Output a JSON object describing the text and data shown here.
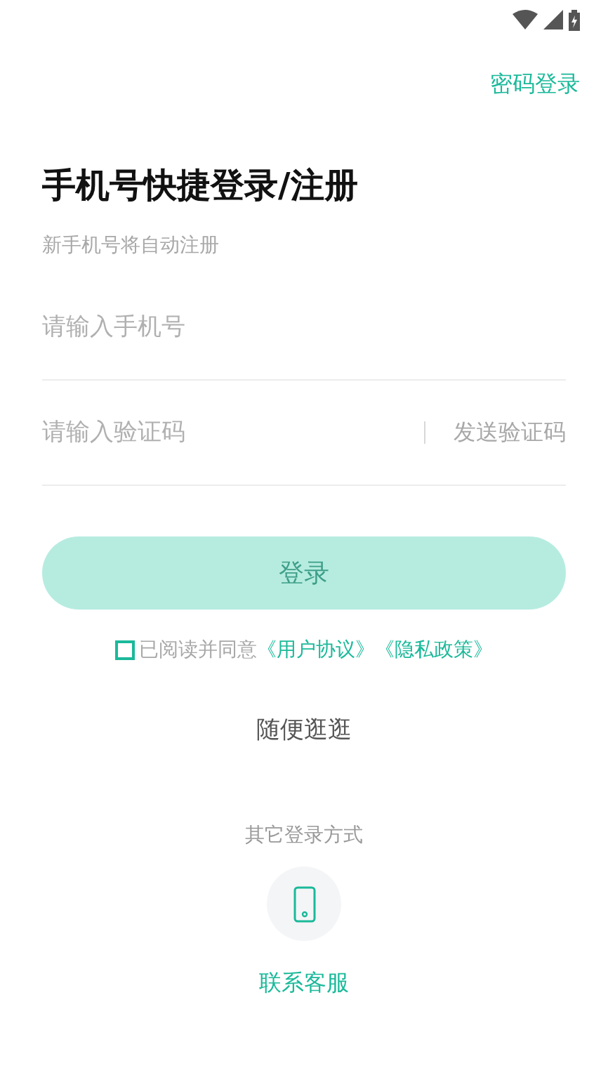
{
  "top_link": "密码登录",
  "title": "手机号快捷登录/注册",
  "subtitle": "新手机号将自动注册",
  "phone_field": {
    "placeholder": "请输入手机号"
  },
  "code_field": {
    "placeholder": "请输入验证码",
    "send_code": "发送验证码"
  },
  "login_button": {
    "label": "登录",
    "disabled": true
  },
  "agreement": {
    "checked": false,
    "text": "已阅读并同意",
    "links": [
      "《用户协议》",
      "《隐私政策》"
    ]
  },
  "browse": "随便逛逛",
  "other_login": {
    "label": "其它登录方式",
    "contact": "联系客服"
  }
}
